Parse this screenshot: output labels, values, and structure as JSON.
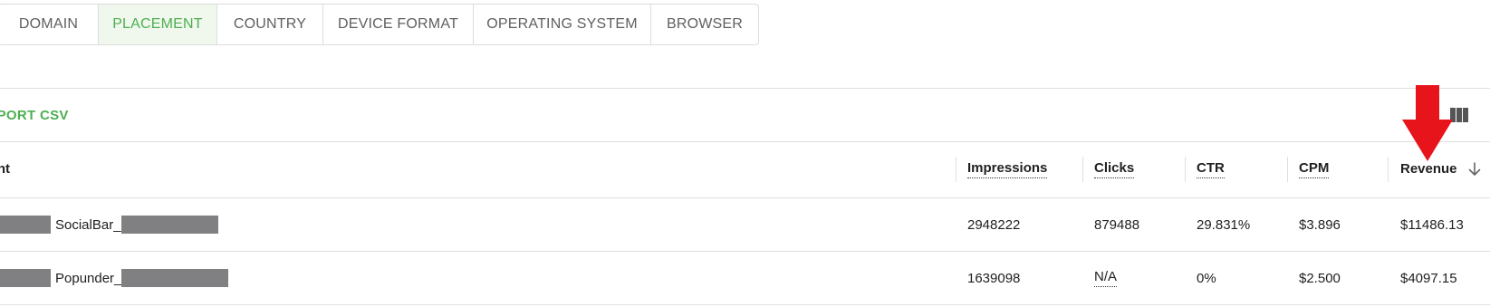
{
  "tabs": [
    {
      "label": "DOMAIN",
      "active": false
    },
    {
      "label": "PLACEMENT",
      "active": true
    },
    {
      "label": "COUNTRY",
      "active": false
    },
    {
      "label": "DEVICE FORMAT",
      "active": false
    },
    {
      "label": "OPERATING SYSTEM",
      "active": false
    },
    {
      "label": "BROWSER",
      "active": false
    }
  ],
  "toolbar": {
    "export_label": "EXPORT CSV",
    "columns_icon": "view-columns-icon"
  },
  "table": {
    "columns": {
      "placement": "Placement",
      "impressions": "Impressions",
      "clicks": "Clicks",
      "ctr": "CTR",
      "cpm": "CPM",
      "revenue": "Revenue"
    },
    "sort_icon": "arrow-down-icon",
    "rows": [
      {
        "placement_name": "SocialBar_",
        "impressions": "2948222",
        "clicks": "879488",
        "ctr": "29.831%",
        "cpm": "$3.896",
        "revenue": "$11486.13"
      },
      {
        "placement_name": "Popunder_",
        "impressions": "1639098",
        "clicks": "N/A",
        "ctr": "0%",
        "cpm": "$2.500",
        "revenue": "$4097.15"
      }
    ]
  },
  "colors": {
    "accent_green": "#4caf50",
    "active_tab_bg": "#f0f8ee",
    "annotation_red": "#e8141c",
    "redaction_gray": "#808083"
  }
}
